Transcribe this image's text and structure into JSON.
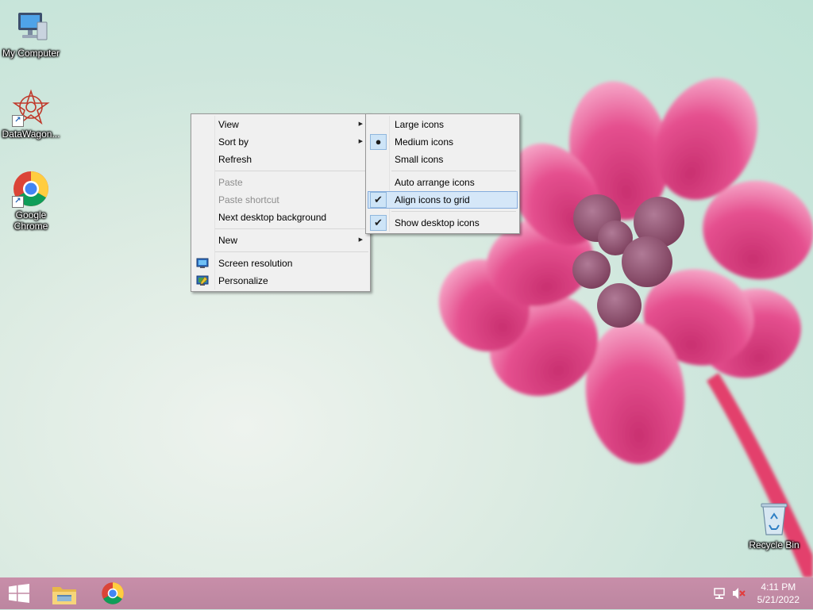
{
  "desktop": {
    "icons": [
      {
        "label": "My Computer"
      },
      {
        "label": "DataWagon..."
      },
      {
        "label": "Google Chrome"
      },
      {
        "label": "Recycle Bin"
      }
    ]
  },
  "context_menu": {
    "items": {
      "view": "View",
      "sort_by": "Sort by",
      "refresh": "Refresh",
      "paste": "Paste",
      "paste_shortcut": "Paste shortcut",
      "next_bg": "Next desktop background",
      "new": "New",
      "screen_resolution": "Screen resolution",
      "personalize": "Personalize"
    }
  },
  "view_submenu": {
    "items": {
      "large": "Large icons",
      "medium": "Medium icons",
      "small": "Small icons",
      "auto_arrange": "Auto arrange icons",
      "align_grid": "Align icons to grid",
      "show_desktop": "Show desktop icons"
    },
    "selected_size": "Medium icons",
    "checked": [
      "Align icons to grid",
      "Show desktop icons"
    ]
  },
  "taskbar": {
    "buttons": [
      "windows-start-icon",
      "file-explorer-icon",
      "chrome-icon"
    ],
    "tray": {
      "time": "4:11 PM",
      "date": "5/21/2022",
      "icons": [
        "network-icon",
        "volume-muted-icon"
      ]
    }
  },
  "colors": {
    "taskbar": "#c088a3",
    "menu_bg": "#f0f0f0",
    "highlight": "#d5e7f8",
    "flower": "#e0407f"
  }
}
